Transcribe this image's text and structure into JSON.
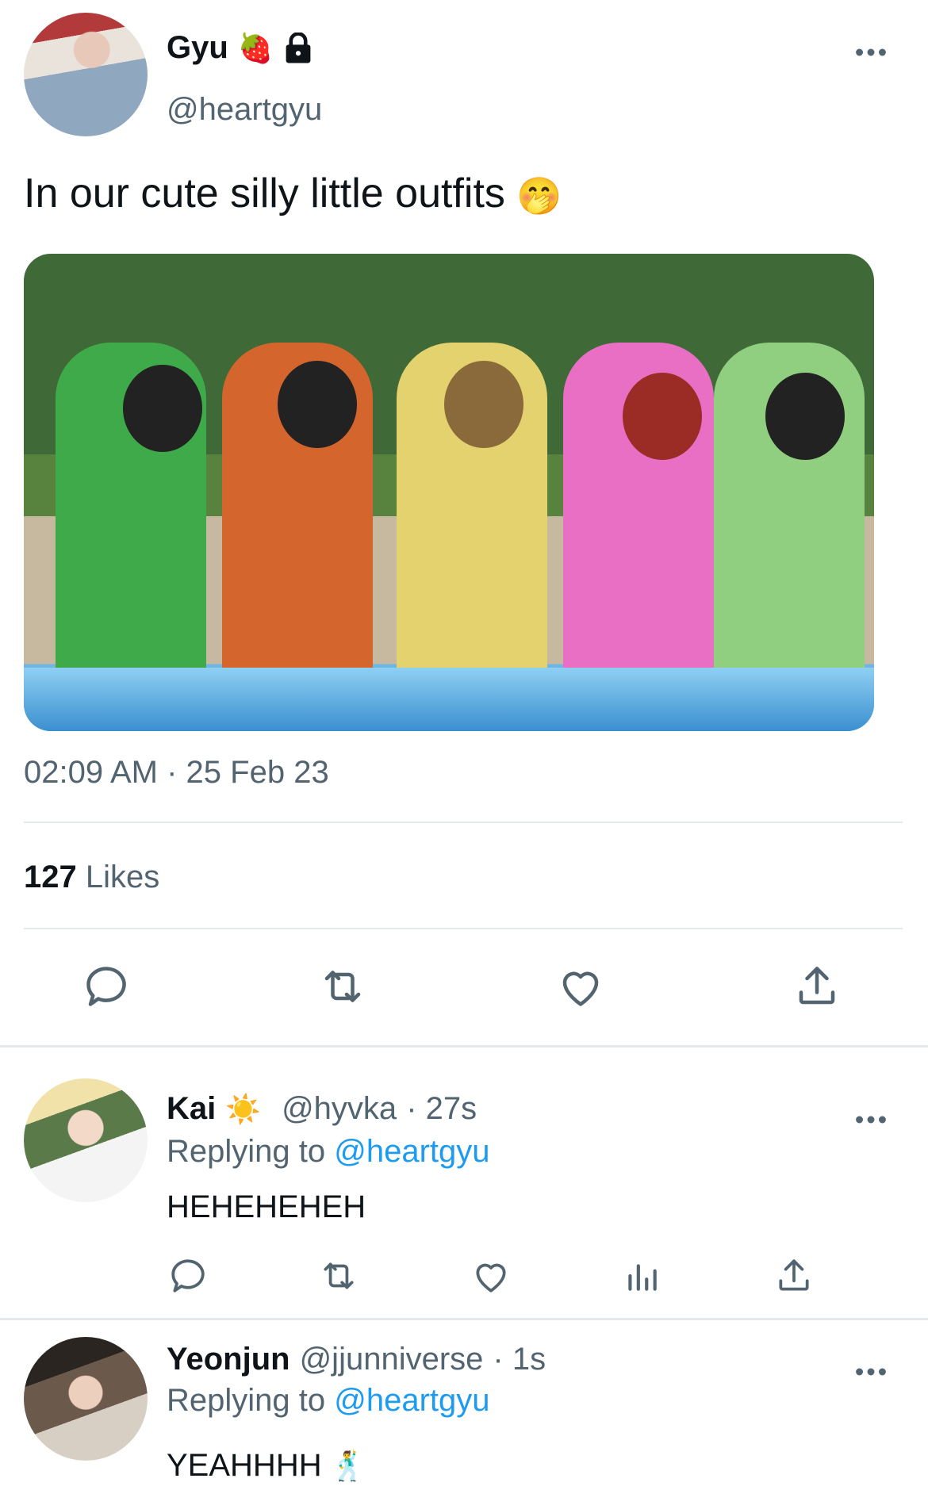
{
  "main_tweet": {
    "author_name": "Gyu",
    "name_emoji": "🍓",
    "lock_icon": "lock-icon",
    "handle": "@heartgyu",
    "text": "In our cute silly little outfits",
    "text_emoji": "🤭",
    "timestamp": "02:09 AM · 25 Feb 23",
    "likes_count": "127",
    "likes_label": "Likes",
    "more_icon": "more-icon"
  },
  "actions": [
    "reply-icon",
    "retweet-icon",
    "like-icon",
    "share-icon"
  ],
  "replies": [
    {
      "name": "Kai",
      "name_emoji": "☀️",
      "handle": "@hyvka",
      "time": "· 27s",
      "replying_prefix": "Replying to",
      "replying_handle": "@heartgyu",
      "text": "HEHEHEHEH"
    },
    {
      "name": "Yeonjun",
      "handle": "@jjunniverse",
      "time": "· 1s",
      "replying_prefix": "Replying to",
      "replying_handle": "@heartgyu",
      "text": "YEAHHHH",
      "text_emoji": "🕺"
    }
  ],
  "reply_actions": [
    "reply-icon",
    "retweet-icon",
    "like-icon",
    "analytics-icon",
    "share-icon"
  ],
  "colors": {
    "link": "#1d9bf0",
    "secondary_text": "#536471",
    "divider": "#e6e9ec"
  }
}
